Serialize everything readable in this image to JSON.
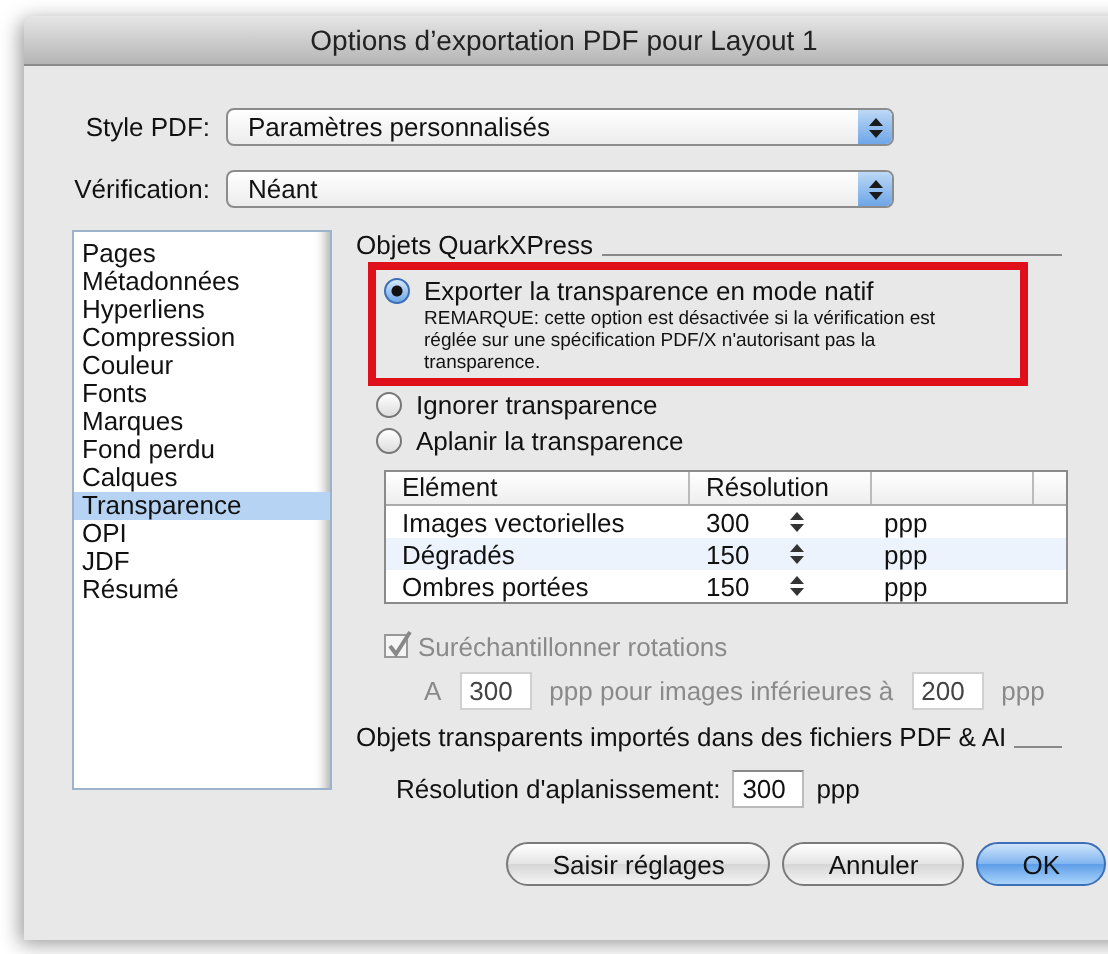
{
  "window": {
    "title": "Options d’exportation PDF pour Layout 1"
  },
  "fields": [
    {
      "label": "Style PDF:",
      "value": "Paramètres personnalisés"
    },
    {
      "label": "Vérification:",
      "value": "Néant"
    }
  ],
  "sidebar": {
    "items": [
      {
        "label": "Pages",
        "selected": false
      },
      {
        "label": "Métadonnées",
        "selected": false
      },
      {
        "label": "Hyperliens",
        "selected": false
      },
      {
        "label": "Compression",
        "selected": false
      },
      {
        "label": "Couleur",
        "selected": false
      },
      {
        "label": "Fonts",
        "selected": false
      },
      {
        "label": "Marques",
        "selected": false
      },
      {
        "label": "Fond perdu",
        "selected": false
      },
      {
        "label": "Calques",
        "selected": false
      },
      {
        "label": "Transparence",
        "selected": true
      },
      {
        "label": "OPI",
        "selected": false
      },
      {
        "label": "JDF",
        "selected": false
      },
      {
        "label": "Résumé",
        "selected": false
      }
    ]
  },
  "quark_group": {
    "title": "Objets QuarkXPress",
    "options": [
      {
        "label": "Exporter la transparence en mode natif",
        "note": "REMARQUE: cette option est désactivée si la vérification est réglée sur une spécification PDF/X n'autorisant pas la transparence.",
        "selected": true,
        "highlighted": true
      },
      {
        "label": "Ignorer transparence",
        "selected": false,
        "highlighted": false
      },
      {
        "label": "Aplanir la transparence",
        "selected": false,
        "highlighted": false
      }
    ],
    "table": {
      "columns": [
        "Elément",
        "Résolution"
      ],
      "rows": [
        {
          "element": "Images vectorielles",
          "resolution": "300",
          "unit": "ppp"
        },
        {
          "element": "Dégradés",
          "resolution": "150",
          "unit": "ppp"
        },
        {
          "element": "Ombres portées",
          "resolution": "150",
          "unit": "ppp"
        }
      ]
    },
    "oversample": {
      "label": "Suréchantillonner rotations",
      "checked": true,
      "disabled": true
    },
    "oversample_row": {
      "prefix": "A",
      "value": "300",
      "middle": "ppp pour images inférieures à",
      "threshold": "200",
      "unit": "ppp",
      "disabled": true
    }
  },
  "imported_group": {
    "title": "Objets transparents importés dans des fichiers PDF & AI",
    "label": "Résolution d'aplanissement:",
    "value": "300",
    "unit": "ppp"
  },
  "buttons": [
    {
      "label": "Saisir réglages",
      "default": false
    },
    {
      "label": "Annuler",
      "default": false
    },
    {
      "label": "OK",
      "default": true
    }
  ]
}
